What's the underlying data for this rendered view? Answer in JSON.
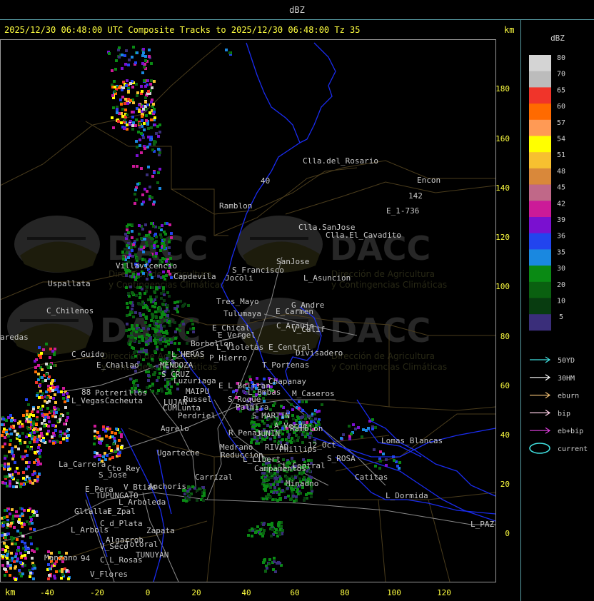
{
  "header": {
    "unit_label": "dBZ",
    "title": "2025/12/30 06:48:00 UTC Composite Tracks to 2025/12/30 06:48:00 Tz 35",
    "km_top": "km",
    "km_bottom": "km"
  },
  "axes": {
    "x_ticks": [
      "-40",
      "-20",
      "0",
      "20",
      "40",
      "60",
      "80",
      "100",
      "120"
    ],
    "y_ticks": [
      "180",
      "160",
      "140",
      "120",
      "100",
      "80",
      "60",
      "40",
      "20",
      "0"
    ]
  },
  "legend": {
    "title": "dBZ",
    "entries": [
      {
        "label": "80",
        "color": "#d4d4d4"
      },
      {
        "label": "70",
        "color": "#bcbcbc"
      },
      {
        "label": "65",
        "color": "#f0342a"
      },
      {
        "label": "60",
        "color": "#ff6a00"
      },
      {
        "label": "57",
        "color": "#ff9a55"
      },
      {
        "label": "54",
        "color": "#ffff00"
      },
      {
        "label": "51",
        "color": "#f7c030"
      },
      {
        "label": "48",
        "color": "#d9883a"
      },
      {
        "label": "45",
        "color": "#c06888"
      },
      {
        "label": "42",
        "color": "#cc1a98"
      },
      {
        "label": "39",
        "color": "#7a10d0"
      },
      {
        "label": "36",
        "color": "#2244ee"
      },
      {
        "label": "35",
        "color": "#1a88e0"
      },
      {
        "label": "30",
        "color": "#0a8a14"
      },
      {
        "label": "20",
        "color": "#0a6010"
      },
      {
        "label": "10",
        "color": "#083c10"
      },
      {
        "label": "5",
        "color": "#3a2e7a"
      }
    ],
    "tracks": [
      {
        "label": "50YD",
        "color": "#40e0e0"
      },
      {
        "label": "30HM",
        "color": "#ffffff"
      },
      {
        "label": "eburn",
        "color": "#e8b870"
      },
      {
        "label": "bip",
        "color": "#ffd0e8"
      },
      {
        "label": "eb+bip",
        "color": "#e040e0"
      },
      {
        "label": "current",
        "color": "#40e0e0"
      }
    ]
  },
  "watermark": {
    "logo_text": "DACC",
    "subtitle_1": "Dirección de Agricultura",
    "subtitle_2": "y Contingencias Climáticas"
  },
  "places": [
    {
      "name": "Clla.del_Rosario"
    },
    {
      "name": "Encon"
    },
    {
      "name": "142"
    },
    {
      "name": "E_1-736"
    },
    {
      "name": "Ramblon"
    },
    {
      "name": "Clla.SanJose"
    },
    {
      "name": "Clla.El_Cavadito"
    },
    {
      "name": "Villavicencio"
    },
    {
      "name": "Capdevila"
    },
    {
      "name": "S_Francisco"
    },
    {
      "name": "SanJose"
    },
    {
      "name": "Jocoli"
    },
    {
      "name": "L_Asuncion"
    },
    {
      "name": "Uspallata"
    },
    {
      "name": "Tres_Mayo"
    },
    {
      "name": "G_Andre"
    },
    {
      "name": "C_Chilenos"
    },
    {
      "name": "Tulumaya"
    },
    {
      "name": "E_Carmen"
    },
    {
      "name": "E_Chical"
    },
    {
      "name": "C_Araujo"
    },
    {
      "name": "V_Calif"
    },
    {
      "name": "aredas"
    },
    {
      "name": "E_Vergel"
    },
    {
      "name": "Borbollon"
    },
    {
      "name": "L_Violetas"
    },
    {
      "name": "E_Central"
    },
    {
      "name": "Divisadero"
    },
    {
      "name": "C_Guido"
    },
    {
      "name": "L_HERAS"
    },
    {
      "name": "P_Hierro"
    },
    {
      "name": "E_Challao"
    },
    {
      "name": "MENDOZA"
    },
    {
      "name": "T_Portenas"
    },
    {
      "name": "S_CRUZ"
    },
    {
      "name": "Luzuriaga"
    },
    {
      "name": "Chapanay"
    },
    {
      "name": "E_L_Beltran"
    },
    {
      "name": "L_Bmbas"
    },
    {
      "name": "M_Caseros"
    },
    {
      "name": "Potrerillos"
    },
    {
      "name": "MAIPU"
    },
    {
      "name": "Russel"
    },
    {
      "name": "L_Vegas"
    },
    {
      "name": "Cacheuta"
    },
    {
      "name": "LUJAN"
    },
    {
      "name": "CUMLunta"
    },
    {
      "name": "S_Roque"
    },
    {
      "name": "Palmira"
    },
    {
      "name": "Perdriel"
    },
    {
      "name": "S_MARTIN"
    },
    {
      "name": "A_Verde"
    },
    {
      "name": "Agrelo"
    },
    {
      "name": "Ramblon"
    },
    {
      "name": "R_Penas"
    },
    {
      "name": "JUNIN"
    },
    {
      "name": "Ugarteche"
    },
    {
      "name": "Lomas_Blancas"
    },
    {
      "name": "Medrano"
    },
    {
      "name": "RIVAD"
    },
    {
      "name": "12_Oct"
    },
    {
      "name": "Phillips"
    },
    {
      "name": "Reduccion"
    },
    {
      "name": "L_Libert"
    },
    {
      "name": "S_ROSA"
    },
    {
      "name": "La_Carrera"
    },
    {
      "name": "Cto_Rey"
    },
    {
      "name": "Campamentos"
    },
    {
      "name": "L_Central"
    },
    {
      "name": "S_Jose"
    },
    {
      "name": "Carrizal"
    },
    {
      "name": "Catitas"
    },
    {
      "name": "Anchoris"
    },
    {
      "name": "Minadno"
    },
    {
      "name": "V_Btias"
    },
    {
      "name": "E_Pera"
    },
    {
      "name": "TUPUNGATO"
    },
    {
      "name": "L_Dormida"
    },
    {
      "name": "L_Arboleda"
    },
    {
      "name": "Gltallar"
    },
    {
      "name": "E_Zpal"
    },
    {
      "name": "C_d_Plata"
    },
    {
      "name": "L_PAZ"
    },
    {
      "name": "L_Arbols"
    },
    {
      "name": "Zapata"
    },
    {
      "name": "Algarrob"
    },
    {
      "name": "V_Seco"
    },
    {
      "name": "Totoral"
    },
    {
      "name": "TUNUYAN"
    },
    {
      "name": "Manzano"
    },
    {
      "name": "C_L_Rosas"
    },
    {
      "name": "V_Flores"
    },
    {
      "name": "40"
    },
    {
      "name": "88"
    },
    {
      "name": "94"
    }
  ]
}
